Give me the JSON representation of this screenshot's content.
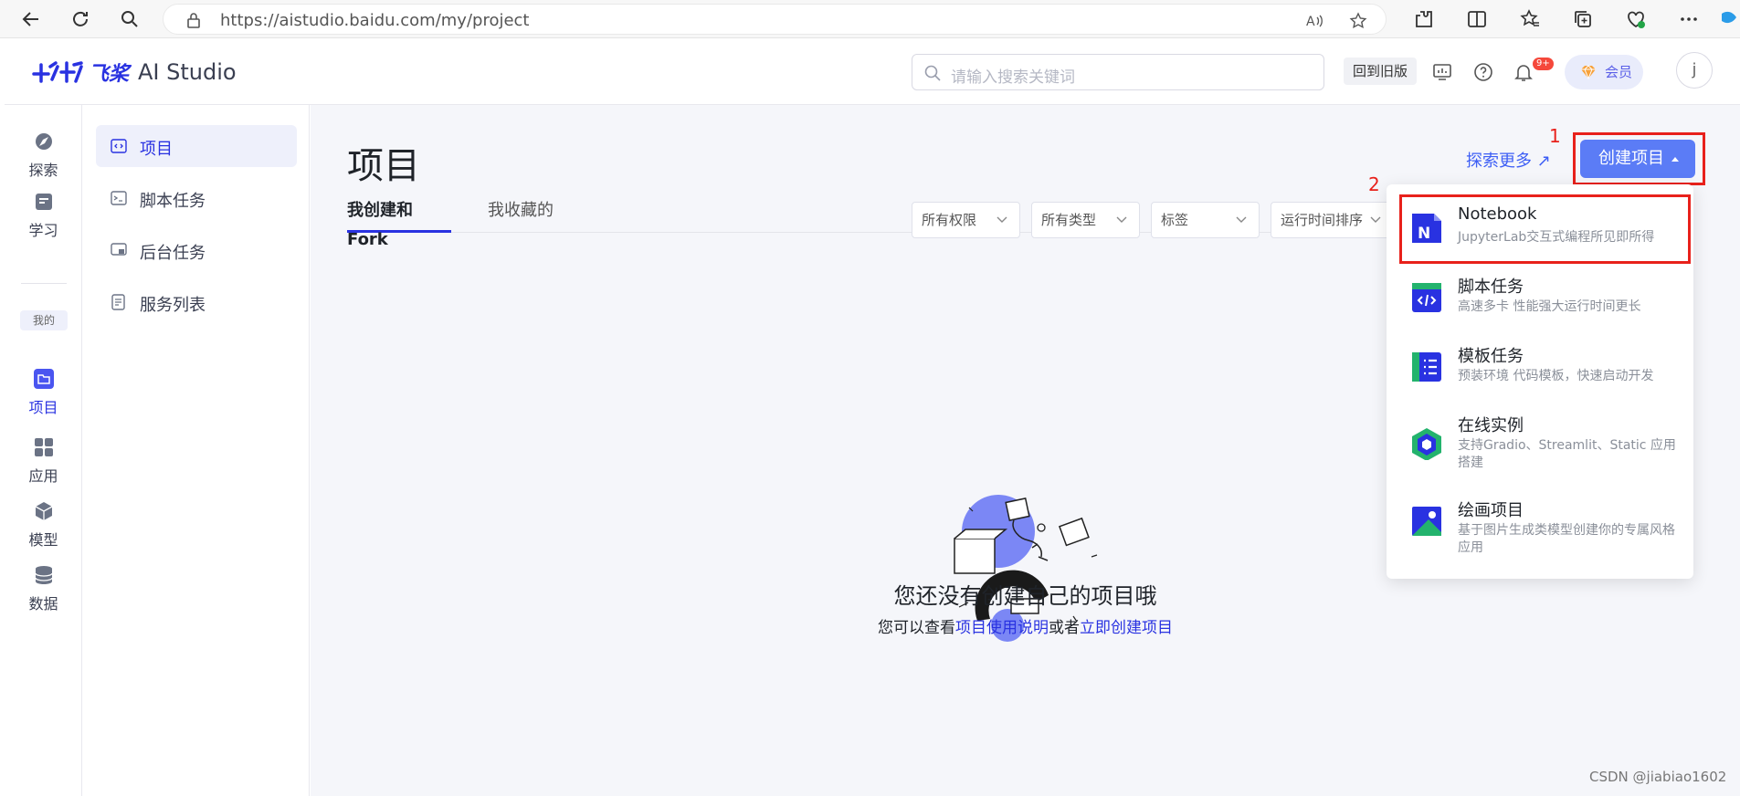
{
  "browser": {
    "url": "https://aistudio.baidu.com/my/project",
    "icons": [
      "back-icon",
      "refresh-icon",
      "search-icon",
      "lock-icon",
      "read-aloud-icon",
      "favorite-star-icon",
      "extensions-icon",
      "split-screen-icon",
      "favorites-icon",
      "collections-icon",
      "health-icon",
      "more-icon",
      "copilot-icon"
    ]
  },
  "header": {
    "logo_cn": "飞桨",
    "logo_en": "AI Studio",
    "search_placeholder": "请输入搜索关键词",
    "old_version": "回到旧版",
    "badge": "9+",
    "member": "会员",
    "avatar": "j"
  },
  "rail": {
    "items": [
      {
        "label": "探索",
        "icon": "explore-icon"
      },
      {
        "label": "学习",
        "icon": "learn-icon"
      },
      {
        "label": "我的",
        "icon": ""
      },
      {
        "label": "项目",
        "icon": "project-icon"
      },
      {
        "label": "应用",
        "icon": "apps-icon"
      },
      {
        "label": "模型",
        "icon": "model-icon"
      },
      {
        "label": "数据",
        "icon": "data-icon"
      }
    ]
  },
  "subnav": {
    "items": [
      {
        "label": "项目",
        "icon": "project-icon"
      },
      {
        "label": "脚本任务",
        "icon": "script-icon"
      },
      {
        "label": "后台任务",
        "icon": "background-task-icon"
      },
      {
        "label": "服务列表",
        "icon": "service-list-icon"
      }
    ]
  },
  "main": {
    "title": "项目",
    "explore_more": "探索更多 ↗",
    "create_button": "创建项目",
    "annotation_1": "1",
    "annotation_2": "2",
    "tabs": [
      {
        "label": "我创建和Fork",
        "active": true
      },
      {
        "label": "我收藏的",
        "active": false
      }
    ],
    "filters": [
      "所有权限",
      "所有类型",
      "标签",
      "运行时间排序"
    ],
    "empty_title": "您还没有创建自己的项目哦",
    "empty_prefix": "您可以查看",
    "empty_link1": "项目使用说明",
    "empty_mid": "或者",
    "empty_link2": "立即创建项目"
  },
  "dropdown": {
    "items": [
      {
        "title": "Notebook",
        "desc": "JupyterLab交互式编程所见即所得",
        "icon": "notebook-icon"
      },
      {
        "title": "脚本任务",
        "desc": "高速多卡 性能强大运行时间更长",
        "icon": "script-task-icon"
      },
      {
        "title": "模板任务",
        "desc": "预装环境 代码模板，快速启动开发",
        "icon": "template-task-icon"
      },
      {
        "title": "在线实例",
        "desc": "支持Gradio、Streamlit、Static 应用搭建",
        "icon": "online-instance-icon"
      },
      {
        "title": "绘画项目",
        "desc": "基于图片生成类模型创建你的专属风格应用",
        "icon": "painting-project-icon"
      }
    ]
  },
  "watermark": "CSDN @jiabiao1602",
  "colors": {
    "brand": "#2932e1",
    "primary_button": "#5b7cf6",
    "annotation_red": "#e8211b"
  }
}
